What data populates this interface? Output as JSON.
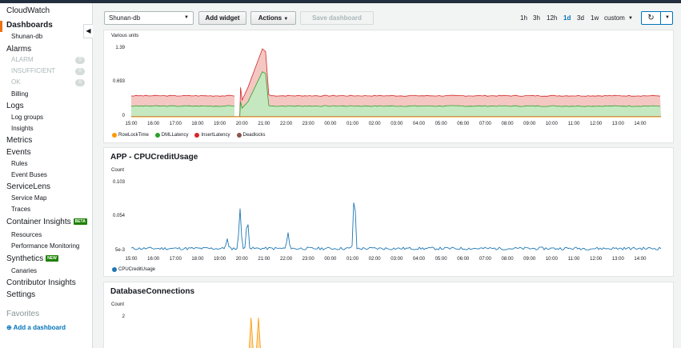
{
  "sidebar": {
    "items": [
      {
        "label": "CloudWatch",
        "level": 0
      },
      {
        "label": "Dashboards",
        "level": 0,
        "active": true
      },
      {
        "label": "Shunan-db",
        "level": 1
      },
      {
        "label": "Alarms",
        "level": 0
      },
      {
        "label": "ALARM",
        "level": 1,
        "dim": true,
        "count": "0"
      },
      {
        "label": "INSUFFICIENT",
        "level": 1,
        "dim": true,
        "count": "0"
      },
      {
        "label": "OK",
        "level": 1,
        "dim": true,
        "count": "0"
      },
      {
        "label": "Billing",
        "level": 1
      },
      {
        "label": "Logs",
        "level": 0
      },
      {
        "label": "Log groups",
        "level": 1
      },
      {
        "label": "Insights",
        "level": 1
      },
      {
        "label": "Metrics",
        "level": 0
      },
      {
        "label": "Events",
        "level": 0
      },
      {
        "label": "Rules",
        "level": 1
      },
      {
        "label": "Event Buses",
        "level": 1
      },
      {
        "label": "ServiceLens",
        "level": 0
      },
      {
        "label": "Service Map",
        "level": 1
      },
      {
        "label": "Traces",
        "level": 1
      },
      {
        "label": "Container Insights",
        "level": 0,
        "badge": "BETA"
      },
      {
        "label": "Resources",
        "level": 1
      },
      {
        "label": "Performance Monitoring",
        "level": 1
      },
      {
        "label": "Synthetics",
        "level": 0,
        "badge": "NEW"
      },
      {
        "label": "Canaries",
        "level": 1
      },
      {
        "label": "Contributor Insights",
        "level": 0
      },
      {
        "label": "Settings",
        "level": 0
      }
    ],
    "favorites_label": "Favorites",
    "add_dashboard_label": "Add a dashboard",
    "collapse_glyph": "◀"
  },
  "toolbar": {
    "dashboard_select": "Shunan-db",
    "add_widget": "Add widget",
    "actions": "Actions",
    "save_dashboard": "Save dashboard",
    "time_ranges": [
      "1h",
      "3h",
      "12h",
      "1d",
      "3d",
      "1w",
      "custom"
    ],
    "selected_time_range": "1d",
    "refresh_icon": "↻"
  },
  "colors": {
    "accent": "#ec7211",
    "link": "#0073bb",
    "row_lock_time": "#ff9900",
    "dml_latency": "#2ca02c",
    "insert_latency": "#d62728",
    "deadlocks": "#8c564b",
    "cpu_credit": "#1f77b4"
  },
  "x_axis_labels": [
    "15:00",
    "16:00",
    "17:00",
    "18:00",
    "19:00",
    "20:00",
    "21:00",
    "22:00",
    "23:00",
    "00:00",
    "01:00",
    "02:00",
    "03:00",
    "04:00",
    "05:00",
    "06:00",
    "07:00",
    "08:00",
    "09:00",
    "10:00",
    "11:00",
    "12:00",
    "13:00",
    "14:00"
  ],
  "chart_data": [
    {
      "type": "area",
      "title": "",
      "ylabel": "Various units",
      "yticks": [
        "1.39",
        "0.693",
        "0"
      ],
      "ylim": [
        0,
        1.39
      ],
      "x_start": "15:00",
      "x_end": "14:30",
      "series": [
        {
          "name": "RowLockTime",
          "color": "#ff9900",
          "values_summary": "approximately 0 throughout"
        },
        {
          "name": "DMLLatency",
          "color": "#2ca02c",
          "values": {
            "baseline": 0.22,
            "gap_at": "19:50",
            "peak_at": "21:00",
            "peak": 0.92
          }
        },
        {
          "name": "InsertLatency",
          "color": "#d62728",
          "values": {
            "baseline": 0.43,
            "gap_at": "19:50",
            "peak_at": "21:00",
            "peak": 1.39
          }
        },
        {
          "name": "Deadlocks",
          "color": "#8c564b",
          "values_summary": "approximately 0 throughout"
        }
      ],
      "legend": [
        "RowLockTime",
        "DMLLatency",
        "InsertLatency",
        "Deadlocks"
      ]
    },
    {
      "type": "line",
      "title": "APP - CPUCreditUsage",
      "ylabel": "Count",
      "yticks": [
        "0.103",
        "0.054",
        "5e-3"
      ],
      "ylim": [
        0.005,
        0.103
      ],
      "series": [
        {
          "name": "CPUCreditUsage",
          "color": "#1f77b4",
          "baseline": 0.008,
          "spikes": [
            {
              "at": "19:55",
              "value": 0.068
            },
            {
              "at": "20:15",
              "value": 0.058
            },
            {
              "at": "19:20",
              "value": 0.025
            },
            {
              "at": "22:05",
              "value": 0.034
            },
            {
              "at": "01:05",
              "value": 0.1
            }
          ]
        }
      ],
      "legend": [
        "CPUCreditUsage"
      ]
    },
    {
      "type": "area",
      "title": "DatabaseConnections",
      "ylabel": "Count",
      "yticks": [
        "2"
      ],
      "series": [
        {
          "name": "DatabaseConnections",
          "color": "#ff9900",
          "spikes_at": [
            "20:25",
            "20:45"
          ],
          "peak": 2
        }
      ]
    }
  ]
}
